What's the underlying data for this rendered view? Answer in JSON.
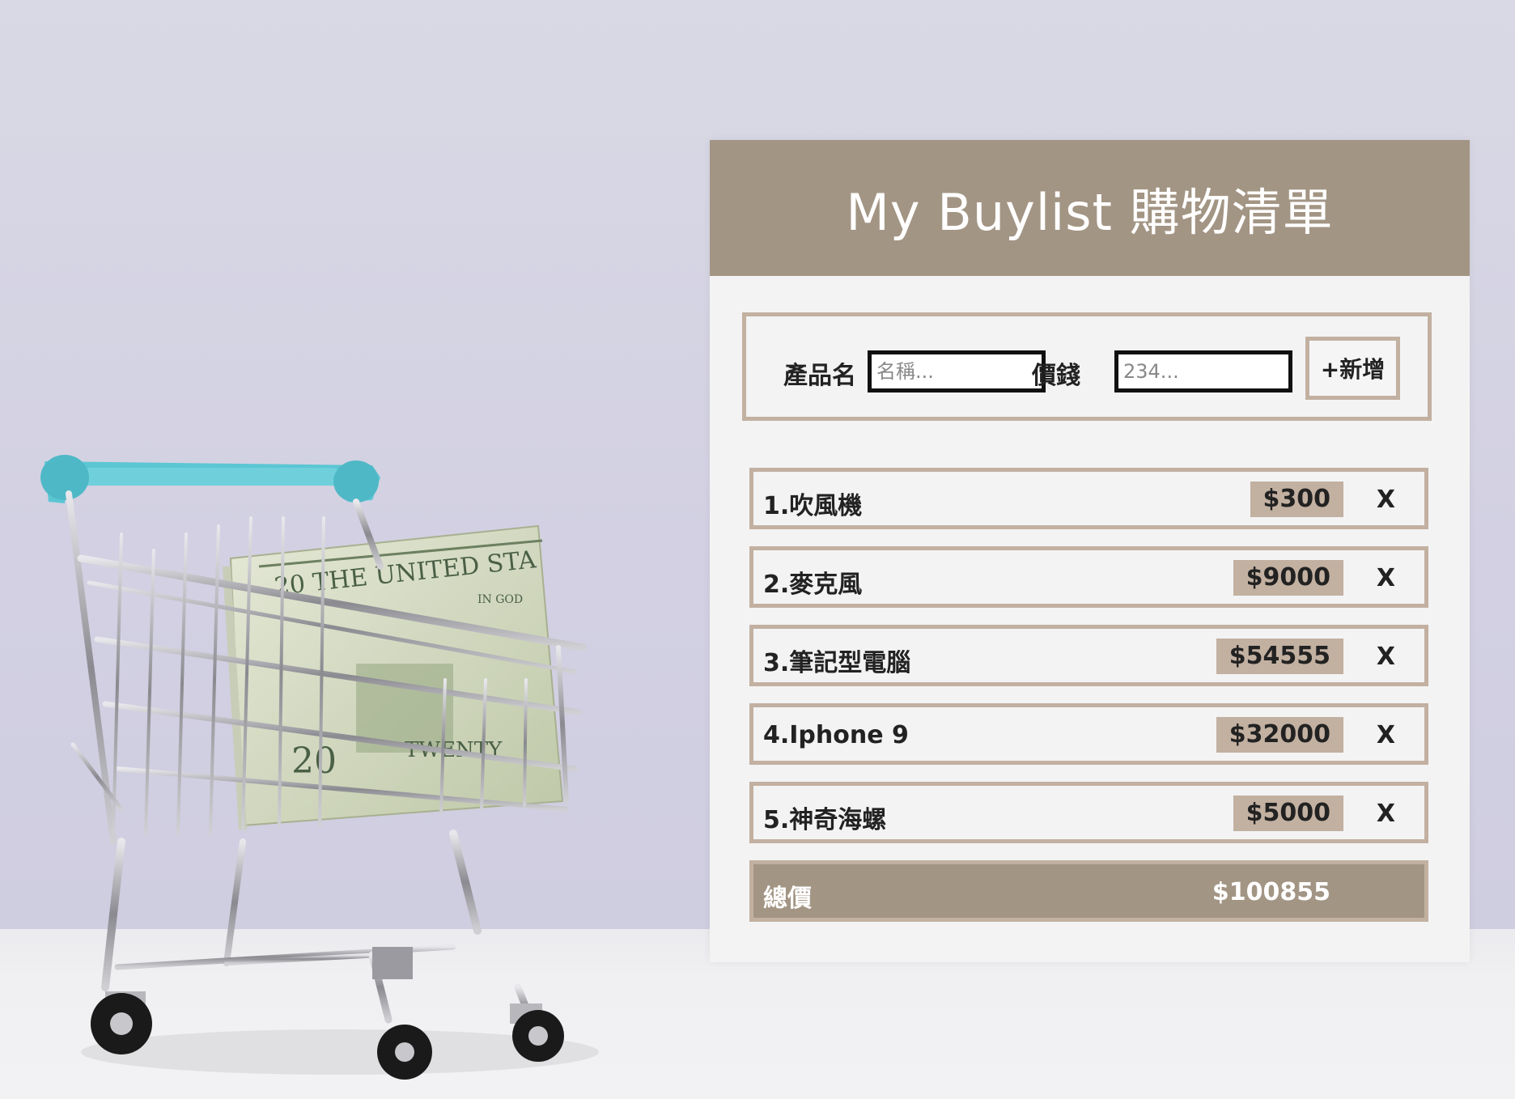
{
  "app": {
    "title": "My Buylist 購物清單"
  },
  "form": {
    "name_label": "產品名",
    "name_placeholder": "名稱...",
    "name_value": "",
    "price_label": "價錢",
    "price_placeholder": "234...",
    "price_value": "",
    "add_label": "+新增"
  },
  "items": [
    {
      "name": "1.吹風機",
      "price": "$300",
      "delete_label": "X"
    },
    {
      "name": "2.麥克風",
      "price": "$9000",
      "delete_label": "X"
    },
    {
      "name": "3.筆記型電腦",
      "price": "$54555",
      "delete_label": "X"
    },
    {
      "name": "4.Iphone 9",
      "price": "$32000",
      "delete_label": "X"
    },
    {
      "name": "5.神奇海螺",
      "price": "$5000",
      "delete_label": "X"
    }
  ],
  "total": {
    "label": "總價",
    "value": "$100855"
  },
  "colors": {
    "accent": "#a39584",
    "border": "#c2b0a1",
    "card_bg": "#f3f3f3",
    "cart_handle": "#5cc6d3"
  },
  "background": {
    "image": "shopping-cart-with-money-photo"
  }
}
